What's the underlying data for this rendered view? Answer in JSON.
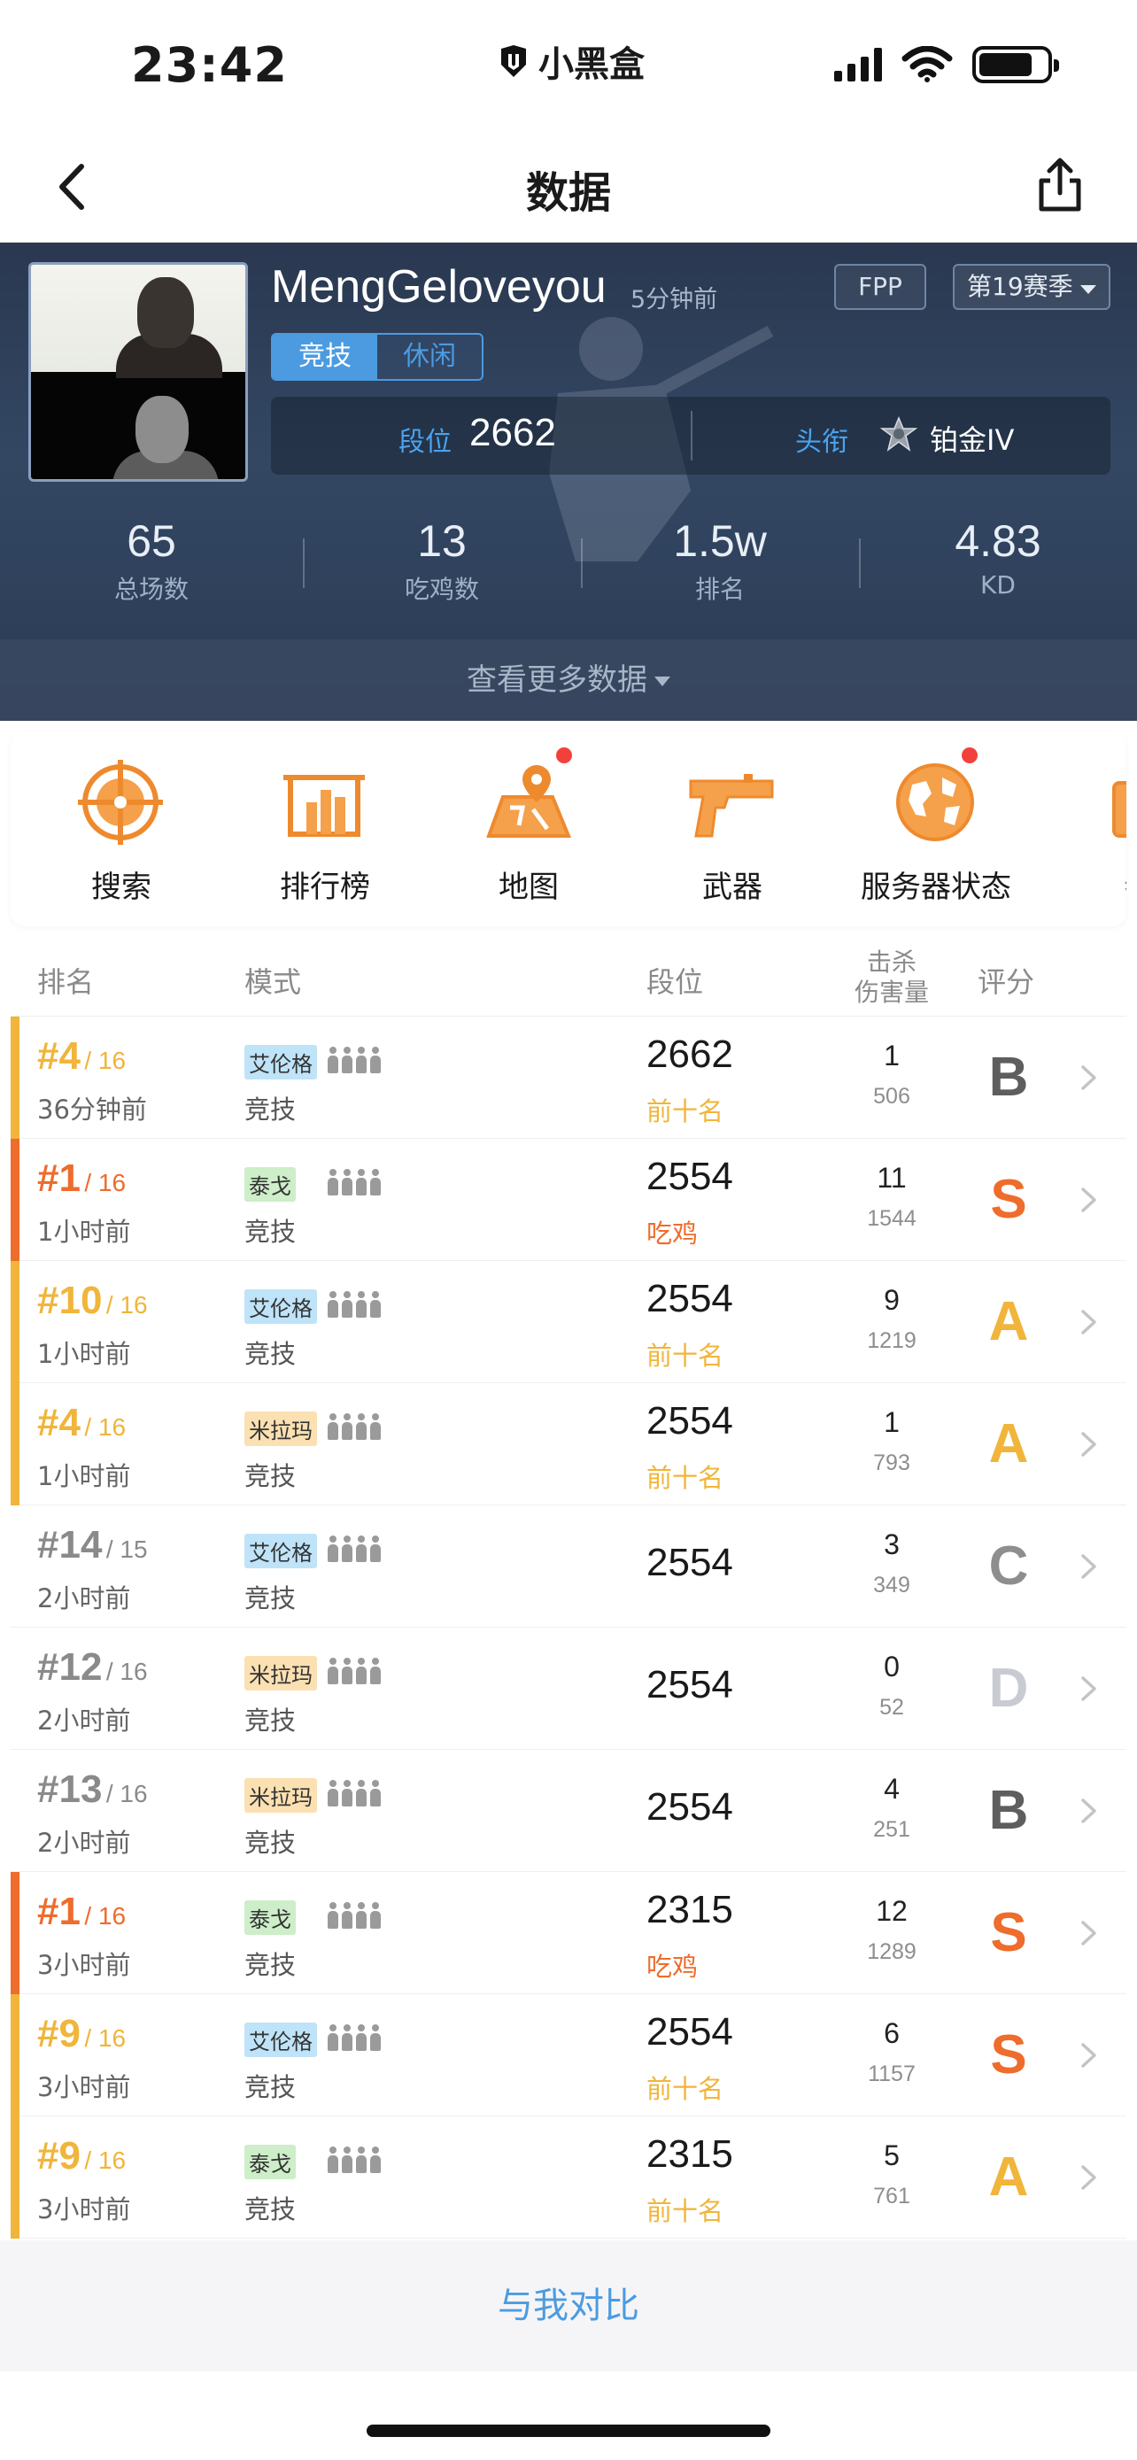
{
  "status_bar": {
    "time": "23:42",
    "carrier": "小黑盒"
  },
  "nav": {
    "title": "数据"
  },
  "profile": {
    "username": "MengGeloveyou",
    "updated": "5分钟前",
    "perspective": "FPP",
    "season": "第19赛季",
    "mode_tabs": [
      "竞技",
      "休闲"
    ],
    "rank_label": "段位",
    "rank_value": "2662",
    "title_label": "头衔",
    "title_value": "铂金IV",
    "stats": [
      {
        "value": "65",
        "label": "总场数"
      },
      {
        "value": "13",
        "label": "吃鸡数"
      },
      {
        "value": "1.5w",
        "label": "排名"
      },
      {
        "value": "4.83",
        "label": "KD"
      }
    ],
    "more_label": "查看更多数据"
  },
  "tools": [
    {
      "label": "搜索",
      "icon": "crosshair-icon"
    },
    {
      "label": "排行榜",
      "icon": "leaderboard-icon"
    },
    {
      "label": "地图",
      "icon": "map-icon"
    },
    {
      "label": "武器",
      "icon": "pistol-icon"
    },
    {
      "label": "服务器状态",
      "icon": "globe-icon"
    },
    {
      "label": "物",
      "icon": "item-icon"
    }
  ],
  "table": {
    "headers": {
      "rank": "排名",
      "mode": "模式",
      "tier": "段位",
      "kills": "击杀",
      "damage": "伤害量",
      "grade": "评分"
    },
    "rows": [
      {
        "place": "#4",
        "total": "/ 16",
        "ago": "36分钟前",
        "map": "艾伦格",
        "mode": "竞技",
        "score": "2662",
        "tag": "前十名",
        "kills": "1",
        "damage": "506",
        "grade": "B"
      },
      {
        "place": "#1",
        "total": "/ 16",
        "ago": "1小时前",
        "map": "泰戈",
        "mode": "竞技",
        "score": "2554",
        "tag": "吃鸡",
        "kills": "11",
        "damage": "1544",
        "grade": "S"
      },
      {
        "place": "#10",
        "total": "/ 16",
        "ago": "1小时前",
        "map": "艾伦格",
        "mode": "竞技",
        "score": "2554",
        "tag": "前十名",
        "kills": "9",
        "damage": "1219",
        "grade": "A"
      },
      {
        "place": "#4",
        "total": "/ 16",
        "ago": "1小时前",
        "map": "米拉玛",
        "mode": "竞技",
        "score": "2554",
        "tag": "前十名",
        "kills": "1",
        "damage": "793",
        "grade": "A"
      },
      {
        "place": "#14",
        "total": "/ 15",
        "ago": "2小时前",
        "map": "艾伦格",
        "mode": "竞技",
        "score": "2554",
        "tag": "",
        "kills": "3",
        "damage": "349",
        "grade": "C"
      },
      {
        "place": "#12",
        "total": "/ 16",
        "ago": "2小时前",
        "map": "米拉玛",
        "mode": "竞技",
        "score": "2554",
        "tag": "",
        "kills": "0",
        "damage": "52",
        "grade": "D"
      },
      {
        "place": "#13",
        "total": "/ 16",
        "ago": "2小时前",
        "map": "米拉玛",
        "mode": "竞技",
        "score": "2554",
        "tag": "",
        "kills": "4",
        "damage": "251",
        "grade": "B"
      },
      {
        "place": "#1",
        "total": "/ 16",
        "ago": "3小时前",
        "map": "泰戈",
        "mode": "竞技",
        "score": "2315",
        "tag": "吃鸡",
        "kills": "12",
        "damage": "1289",
        "grade": "S"
      },
      {
        "place": "#9",
        "total": "/ 16",
        "ago": "3小时前",
        "map": "艾伦格",
        "mode": "竞技",
        "score": "2554",
        "tag": "前十名",
        "kills": "6",
        "damage": "1157",
        "grade": "S"
      },
      {
        "place": "#9",
        "total": "/ 16",
        "ago": "3小时前",
        "map": "泰戈",
        "mode": "竞技",
        "score": "2315",
        "tag": "前十名",
        "kills": "5",
        "damage": "761",
        "grade": "A"
      }
    ]
  },
  "compare_label": "与我对比",
  "colors": {
    "accent": "#4c9be0",
    "win": "#ee6c2c",
    "top10": "#f0b53a",
    "grade_S": "#ee6c2c",
    "grade_A": "#f0b53a",
    "grade_B": "#5e5e5e",
    "grade_C": "#8e8e8e",
    "grade_D": "#c8cbd2",
    "map_艾伦格": "#bfe3f8",
    "map_泰戈": "#cdeec8",
    "map_米拉玛": "#fbe0b2"
  }
}
